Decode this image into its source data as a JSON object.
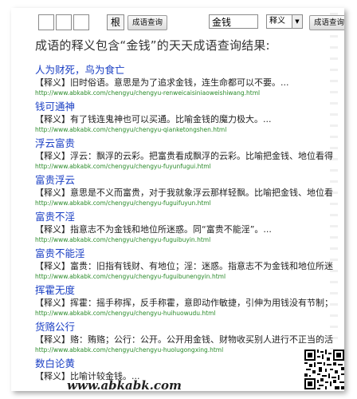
{
  "search_bar": {
    "char_label": "根",
    "btn_left_label": "成语查询",
    "query_value": "金钱",
    "mode_selected": "释义",
    "btn_right_label": "成语查询"
  },
  "heading": "成语的释义包含“金钱”的天天成语查询结果:",
  "results": [
    {
      "title": "人为财死，鸟为食亡",
      "desc": "【释义】旧时俗语。意思是为了追求金钱，连生命都可以不要。...",
      "url": "http://www.abkabk.com/chengyu/chengyu-renweicaisiniaoweishiwang.html"
    },
    {
      "title": "钱可通神",
      "desc": "【释义】有了钱连鬼神也可以买通。比喻金钱的魔力极大。...",
      "url": "http://www.abkabk.com/chengyu/chengyu-qianketongshen.html"
    },
    {
      "title": "浮云富贵",
      "desc": "【释义】浮云：飘浮的云彩。把富贵看成飘浮的云彩。比喻把金钱、地位看得",
      "url": "http://www.abkabk.com/chengyu/chengyu-fuyunfugui.html"
    },
    {
      "title": "富贵浮云",
      "desc": "【释义】意思是不义而富贵，对于我就象浮云那样轻飘。比喻把金钱、地位看",
      "url": "http://www.abkabk.com/chengyu/chengyu-fuguifuyun.html"
    },
    {
      "title": "富贵不淫",
      "desc": "【释义】指意志不为金钱和地位所迷惑。同“富贵不能淫”。...",
      "url": "http://www.abkabk.com/chengyu/chengyu-fuguibuyin.html"
    },
    {
      "title": "富贵不能淫",
      "desc": "【释义】富贵：旧指有钱财、有地位；淫：迷惑。指意志不为金钱和地位所迷",
      "url": "http://www.abkabk.com/chengyu/chengyu-fuguibunengyin.html"
    },
    {
      "title": "挥霍无度",
      "desc": "【释义】挥霍：摇手称挥，反手称霍，意即动作敏捷，引伸为用钱没有节制；",
      "url": "http://www.abkabk.com/chengyu/chengyu-huihuowudu.html"
    },
    {
      "title": "货赂公行",
      "desc": "【释义】赂：贿赂；公行：公开。公开用金钱、财物收买别人进行不正当的活",
      "url": "http://www.abkabk.com/chengyu/chengyu-huolugongxing.html"
    },
    {
      "title": "数白论黄",
      "desc": "【释义】比喻计较金钱。...",
      "url": ""
    }
  ],
  "watermark": "www.abkabk.com"
}
